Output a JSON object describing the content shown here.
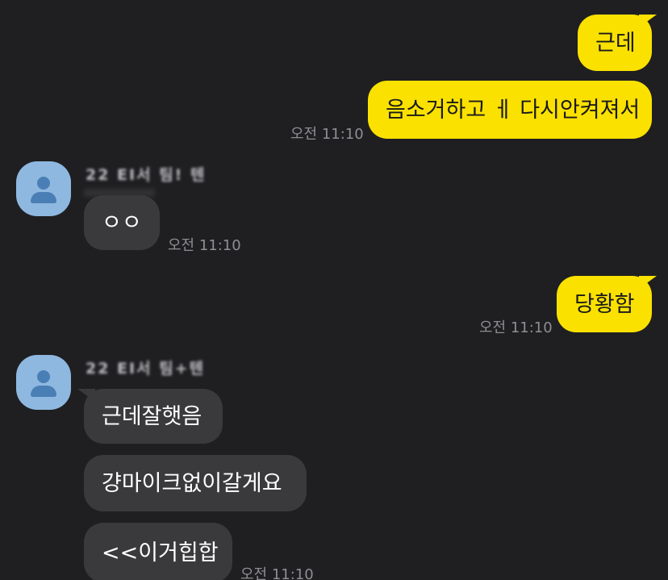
{
  "messages": {
    "m1": {
      "text": "근데"
    },
    "m2": {
      "text": "음소거하고 ㅔ 다시안켜져서",
      "time": "오전 11:10"
    },
    "m3": {
      "sender": "22 EI서 팀! 텐",
      "text": "ㅇㅇ",
      "time": "오전 11:10"
    },
    "m4": {
      "text": "당황함",
      "time": "오전 11:10"
    },
    "m5": {
      "sender": "22 EI서 팀+텐",
      "text": "근데잘햇음"
    },
    "m6": {
      "text": "걍마이크없이갈게요"
    },
    "m7": {
      "text": "<<이거힙합",
      "time": "오전 11:10"
    }
  },
  "colors": {
    "background": "#1f1f21",
    "my_bubble": "#fae100",
    "their_bubble": "#3a3a3c",
    "avatar": "#8fb8e0",
    "timestamp": "#8e8e93"
  },
  "icons": {
    "avatar": "default-profile-person-icon"
  }
}
